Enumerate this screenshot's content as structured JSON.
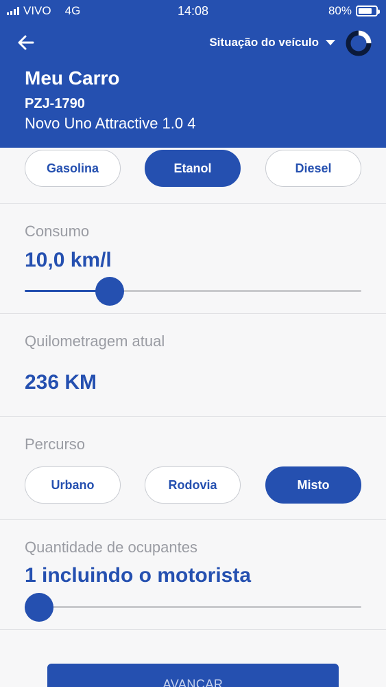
{
  "status_bar": {
    "carrier": "VIVO",
    "network": "4G",
    "time": "14:08",
    "battery": "80%"
  },
  "header": {
    "title": "Situação do veículo",
    "car_name": "Meu Carro",
    "plate": "PZJ-1790",
    "model": "Novo Uno Attractive 1.0 4"
  },
  "fuel": {
    "options": [
      "Gasolina",
      "Etanol",
      "Diesel"
    ],
    "selected": "Etanol"
  },
  "consumo": {
    "label": "Consumo",
    "value": "10,0 km/l",
    "slider_fraction": 0.21
  },
  "quilometragem": {
    "label": "Quilometragem atual",
    "value": "236 KM"
  },
  "percurso": {
    "label": "Percurso",
    "options": [
      "Urbano",
      "Rodovia",
      "Misto"
    ],
    "selected": "Misto"
  },
  "ocupantes": {
    "label": "Quantidade de ocupantes",
    "value": "1 incluindo o motorista",
    "slider_fraction": 0.0
  },
  "footer": {
    "button_label": "AVANÇAR"
  },
  "colors": {
    "primary": "#2550b0",
    "background": "#f7f7f8",
    "label_gray": "#9a9ca3"
  },
  "icons": {
    "back": "arrow-left-icon",
    "dropdown": "caret-down-icon",
    "status": "donut-progress-icon"
  }
}
